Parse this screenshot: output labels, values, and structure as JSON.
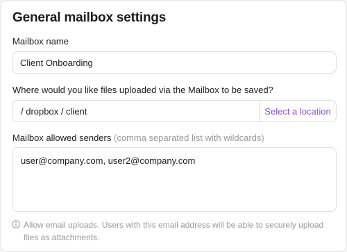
{
  "title": "General mailbox settings",
  "mailbox_name": {
    "label": "Mailbox name",
    "value": "Client Onboarding"
  },
  "upload_location": {
    "label": "Where would you like files uploaded via the Mailbox to be saved?",
    "path": "/ dropbox / client",
    "select_label": "Select a location"
  },
  "allowed_senders": {
    "label": "Mailbox allowed senders",
    "hint": "(comma separated list with wildcards)",
    "value": "user@company.com, user2@company.com"
  },
  "help": {
    "icon": "info-icon",
    "text": "Allow email uploads. Users with this email address will be able to securely upload files as attachments."
  },
  "colors": {
    "accent": "#8a4fe0",
    "muted_text": "#9a9aa0",
    "border": "#dedee2"
  }
}
